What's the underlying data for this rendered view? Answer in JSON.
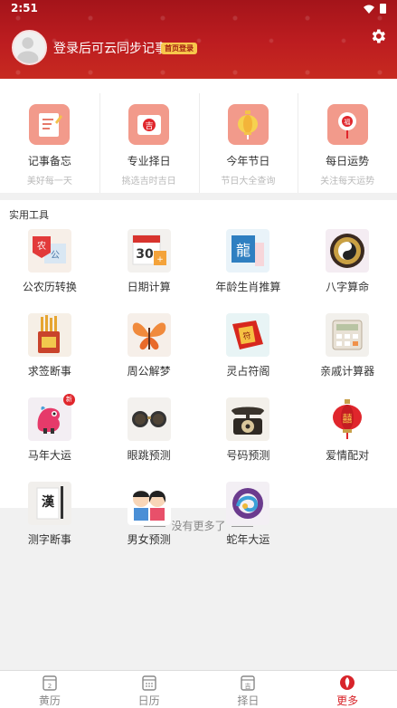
{
  "status_bar": {
    "time": "2:51"
  },
  "header": {
    "login_text": "登录后可云同步记事",
    "badge": "首页登录",
    "bg_color": "#bd1d20"
  },
  "quick_items": [
    {
      "title": "记事备忘",
      "subtitle": "美好每一天",
      "icon": "notepad-icon"
    },
    {
      "title": "专业择日",
      "subtitle": "挑选吉时吉日",
      "icon": "lucky-day-icon"
    },
    {
      "title": "今年节日",
      "subtitle": "节日大全查询",
      "icon": "lantern-icon"
    },
    {
      "title": "每日运势",
      "subtitle": "关注每天运势",
      "icon": "charm-icon"
    }
  ],
  "tools": {
    "title": "实用工具",
    "items": [
      {
        "label": "公农历转换",
        "icon": "calendar-convert-icon"
      },
      {
        "label": "日期计算",
        "icon": "date-calc-icon"
      },
      {
        "label": "年龄生肖推算",
        "icon": "zodiac-dragon-icon"
      },
      {
        "label": "八字算命",
        "icon": "bagua-icon"
      },
      {
        "label": "求签断事",
        "icon": "fortune-sticks-icon"
      },
      {
        "label": "周公解梦",
        "icon": "butterfly-icon"
      },
      {
        "label": "灵占符阁",
        "icon": "talisman-icon"
      },
      {
        "label": "亲戚计算器",
        "icon": "calculator-icon"
      },
      {
        "label": "马年大运",
        "icon": "horse-icon",
        "new_badge": "新"
      },
      {
        "label": "眼跳预测",
        "icon": "glasses-icon"
      },
      {
        "label": "号码预测",
        "icon": "telephone-icon"
      },
      {
        "label": "爱情配对",
        "icon": "love-lantern-icon"
      },
      {
        "label": "测字断事",
        "icon": "calligraphy-icon"
      },
      {
        "label": "男女预测",
        "icon": "boy-girl-icon"
      },
      {
        "label": "蛇年大运",
        "icon": "snake-icon"
      }
    ]
  },
  "no_more_text": "没有更多了",
  "bottom_nav": [
    {
      "label": "黄历",
      "icon": "almanac-icon",
      "active": false
    },
    {
      "label": "日历",
      "icon": "calendar-icon",
      "active": false
    },
    {
      "label": "择日",
      "icon": "choose-day-icon",
      "active": false
    },
    {
      "label": "更多",
      "icon": "more-icon",
      "active": true
    }
  ],
  "colors": {
    "accent": "#d8242a",
    "header_red": "#bd1d20",
    "card_pink": "#f29a8b"
  }
}
